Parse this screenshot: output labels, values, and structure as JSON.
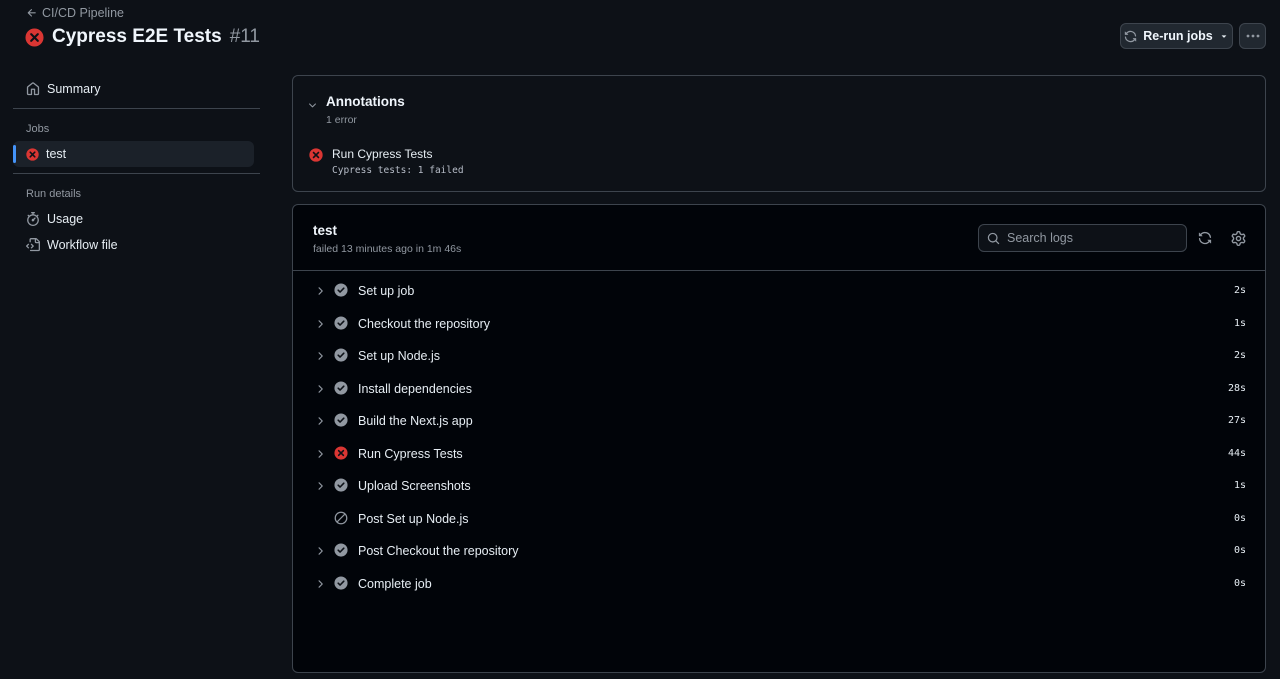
{
  "header": {
    "back_label": "CI/CD Pipeline",
    "title": "Cypress E2E Tests",
    "run_number": "#11",
    "rerun_label": "Re-run jobs"
  },
  "sidebar": {
    "summary_label": "Summary",
    "jobs_heading": "Jobs",
    "jobs": [
      {
        "label": "test",
        "status": "failed"
      }
    ],
    "run_details_heading": "Run details",
    "usage_label": "Usage",
    "workflow_label": "Workflow file"
  },
  "annotations": {
    "title": "Annotations",
    "count": "1 error",
    "items": [
      {
        "title": "Run Cypress Tests",
        "message": "Cypress tests: 1 failed",
        "level": "error"
      }
    ]
  },
  "job": {
    "name": "test",
    "status_text": "failed 13 minutes ago in 1m 46s",
    "search_placeholder": "Search logs",
    "steps": [
      {
        "name": "Set up job",
        "duration": "2s",
        "status": "success",
        "expandable": true
      },
      {
        "name": "Checkout the repository",
        "duration": "1s",
        "status": "success",
        "expandable": true
      },
      {
        "name": "Set up Node.js",
        "duration": "2s",
        "status": "success",
        "expandable": true
      },
      {
        "name": "Install dependencies",
        "duration": "28s",
        "status": "success",
        "expandable": true
      },
      {
        "name": "Build the Next.js app",
        "duration": "27s",
        "status": "success",
        "expandable": true
      },
      {
        "name": "Run Cypress Tests",
        "duration": "44s",
        "status": "failure",
        "expandable": true
      },
      {
        "name": "Upload Screenshots",
        "duration": "1s",
        "status": "success",
        "expandable": true
      },
      {
        "name": "Post Set up Node.js",
        "duration": "0s",
        "status": "skipped",
        "expandable": false
      },
      {
        "name": "Post Checkout the repository",
        "duration": "0s",
        "status": "success",
        "expandable": true
      },
      {
        "name": "Complete job",
        "duration": "0s",
        "status": "success",
        "expandable": true
      }
    ]
  },
  "colors": {
    "background": "#0d1117",
    "panel": "#010409",
    "border": "#3d444d",
    "failure": "#da3633",
    "success_icon": "#9198a1",
    "accent": "#4493f8"
  }
}
